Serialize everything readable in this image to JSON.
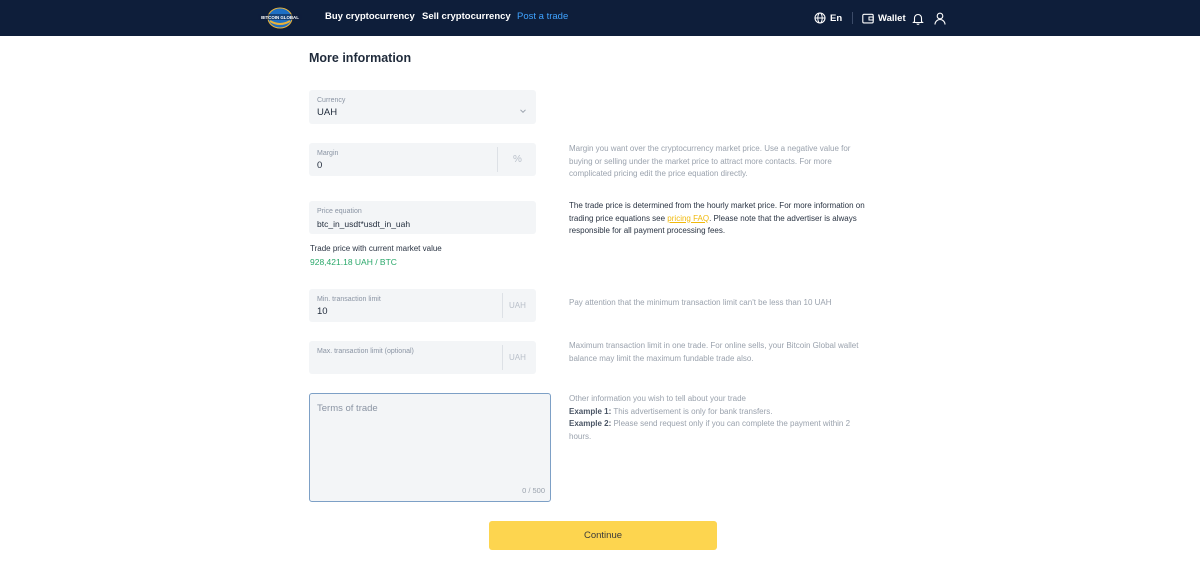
{
  "header": {
    "logo_text": "BITCOIN GLOBAL",
    "nav": {
      "buy": "Buy cryptocurrency",
      "sell": "Sell cryptocurrency",
      "post": "Post a trade"
    },
    "language": "En",
    "wallet": "Wallet",
    "icons": [
      "globe-icon",
      "wallet-icon",
      "bell-icon",
      "user-icon"
    ]
  },
  "page": {
    "title": "More information"
  },
  "form": {
    "currency": {
      "label": "Currency",
      "value": "UAH"
    },
    "margin": {
      "label": "Margin",
      "value": "0",
      "unit": "%",
      "help": "Margin you want over the cryptocurrency market price. Use a negative value for buying or selling under the market price to attract more contacts. For more complicated pricing edit the price equation directly."
    },
    "price_equation": {
      "label": "Price equation",
      "value": "btc_in_usdt*usdt_in_uah",
      "help_part1": "The trade price is determined from the hourly market price. For more information on trading price equations see",
      "help_link": "pricing FAQ",
      "help_part2": ". Please note that the advertiser is always responsible for all payment processing fees."
    },
    "trade_price": {
      "label": "Trade price with current market value",
      "value": "928,421.18 UAH / BTC"
    },
    "min_limit": {
      "label": "Min. transaction limit",
      "value": "10",
      "unit": "UAH",
      "help": "Pay attention that the minimum transaction limit can't be less than 10 UAH"
    },
    "max_limit": {
      "label": "Max. transaction limit (optional)",
      "value": "",
      "unit": "UAH",
      "help": "Maximum transaction limit in one trade. For online sells, your Bitcoin Global wallet balance may limit the maximum fundable trade also."
    },
    "terms": {
      "placeholder": "Terms of trade",
      "counter": "0 / 500",
      "help_intro": "Other information you wish to tell about your trade",
      "example1_label": "Example 1:",
      "example1_text": " This advertisement is only for bank transfers.",
      "example2_label": "Example 2:",
      "example2_text": " Please send request only if you can complete the payment within 2 hours."
    },
    "continue_label": "Continue"
  },
  "colors": {
    "header_bg": "#0e1e3a",
    "accent_link": "#3fa3ff",
    "button": "#fdd54f",
    "price_green": "#2aa86a",
    "faq_link": "#f0b90b"
  }
}
